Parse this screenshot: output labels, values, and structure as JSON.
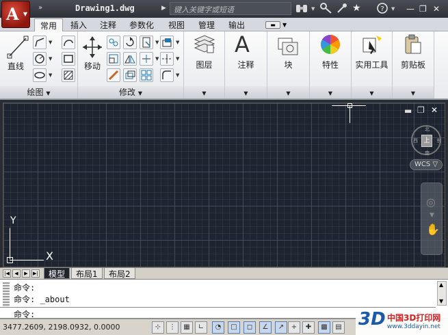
{
  "title_bar": {
    "app_logo": "A",
    "qat_more": "»",
    "document_title": "Drawing1.dwg",
    "search_placeholder": "键入关键字或短语",
    "icons": [
      "binoculars-icon",
      "key-icon",
      "star-icon",
      "help-icon"
    ],
    "window_buttons": [
      "minimize-icon",
      "restore-icon",
      "close-icon"
    ]
  },
  "tabs": [
    "常用",
    "插入",
    "注释",
    "参数化",
    "视图",
    "管理",
    "输出"
  ],
  "active_tab": "常用",
  "ribbon": {
    "draw_panel": {
      "title": "绘图",
      "line_label": "直线"
    },
    "modify_panel": {
      "title": "修改",
      "move_label": "移动"
    },
    "layers_label": "图层",
    "annotation_label": "注释",
    "block_label": "块",
    "properties_label": "特性",
    "utilities_label": "实用工具",
    "clipboard_label": "剪贴板"
  },
  "viewport": {
    "viewcube_face": "上",
    "viewcube_dirs": {
      "n": "北",
      "s": "南",
      "w": "西",
      "e": "东"
    },
    "wcs_label": "WCS",
    "ucs_x": "X",
    "ucs_y": "Y",
    "window_controls": [
      "minimize-icon",
      "restore-icon",
      "close-icon"
    ]
  },
  "layout_tabs": [
    "模型",
    "布局1",
    "布局2"
  ],
  "active_layout": "模型",
  "command": {
    "history": [
      "命令:",
      "命令: _about"
    ],
    "prompt": "命令:"
  },
  "status_bar": {
    "coordinates": "3477.2609, 2198.0932, 0.0000"
  },
  "watermark": {
    "mark": "3D",
    "name": "中国3D打印网",
    "url": "www.3ddayin.net"
  }
}
